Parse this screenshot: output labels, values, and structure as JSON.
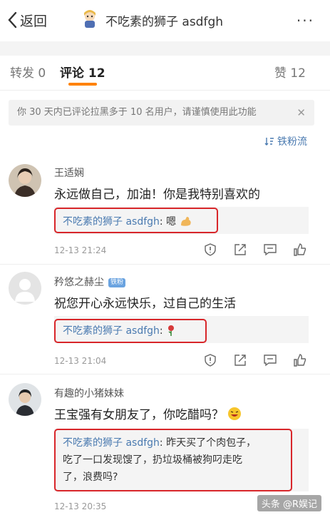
{
  "header": {
    "back_label": "返回",
    "title": "不吃素的狮子 asdfgh",
    "more": "···"
  },
  "tabs": [
    {
      "label": "转发 0"
    },
    {
      "label": "评论 12"
    },
    {
      "label": "赞 12"
    }
  ],
  "notice": {
    "text": "你 30 天内已评论拉黑多于 10 名用户，请谨慎使用此功能",
    "close": "✕"
  },
  "fan_flow": {
    "label": "铁粉流"
  },
  "comments": [
    {
      "name": "王适娴",
      "text": "永远做自己，加油！你是我特别喜欢的",
      "reply_name": "不吃素的狮子 asdfgh",
      "reply_text": "嗯",
      "time": "12-13 21:24"
    },
    {
      "name": "矜悠之赫尘",
      "badge": "铁粉",
      "text": "祝您开心永远快乐，过自己的生活",
      "reply_name": "不吃素的狮子 asdfgh",
      "reply_text": "",
      "time": "12-13 21:04"
    },
    {
      "name": "有趣的小猪妹妹",
      "text": "王宝强有女朋友了，你吃醋吗？",
      "reply_name": "不吃素的狮子 asdfgh",
      "reply_line1": "昨天买了个肉包子，",
      "reply_line2": "吃了一口发现馊了，扔垃圾桶被狗叼走吃",
      "reply_line3": "了，浪费吗?",
      "time": "12-13 20:35"
    }
  ],
  "watermark": "头条 @R娱记"
}
